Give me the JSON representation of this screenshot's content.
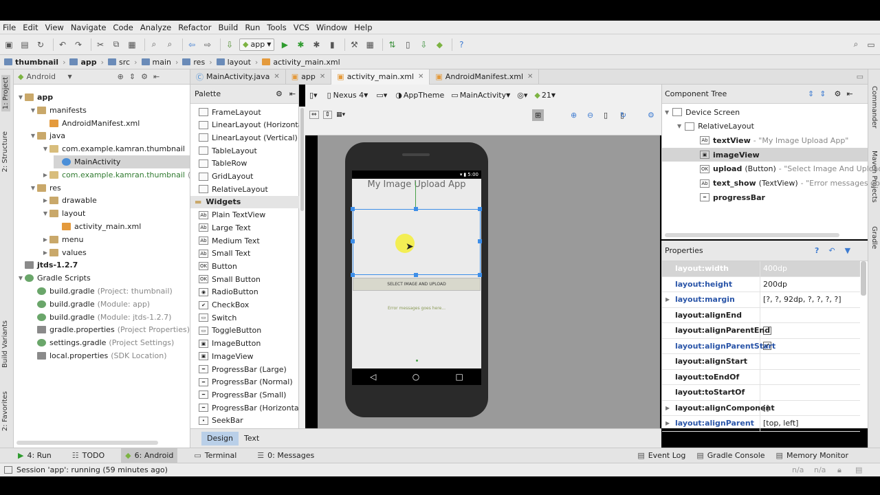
{
  "menu": [
    "File",
    "Edit",
    "View",
    "Navigate",
    "Code",
    "Analyze",
    "Refactor",
    "Build",
    "Run",
    "Tools",
    "VCS",
    "Window",
    "Help"
  ],
  "toolbar": {
    "run_config": "app"
  },
  "breadcrumb": [
    "thumbnail",
    "app",
    "src",
    "main",
    "res",
    "layout",
    "activity_main.xml"
  ],
  "left_strip": {
    "project": "1: Project",
    "structure": "2: Structure",
    "build_variants": "Build Variants",
    "favorites": "2: Favorites"
  },
  "right_strip": {
    "commander": "Commander",
    "maven": "Maven Projects",
    "gradle": "Gradle"
  },
  "project_panel": {
    "view": "Android"
  },
  "tree": [
    {
      "label": "app",
      "indent": 0,
      "arrow": "▼",
      "icon": "folder",
      "bold": true
    },
    {
      "label": "manifests",
      "indent": 1,
      "arrow": "▼",
      "icon": "folder"
    },
    {
      "label": "AndroidManifest.xml",
      "indent": 2,
      "arrow": "",
      "icon": "xml"
    },
    {
      "label": "java",
      "indent": 1,
      "arrow": "▼",
      "icon": "folder"
    },
    {
      "label": "com.example.kamran.thumbnail",
      "indent": 2,
      "arrow": "▼",
      "icon": "pkg"
    },
    {
      "label": "MainActivity",
      "indent": 3,
      "arrow": "",
      "icon": "cls",
      "selected": true
    },
    {
      "label": "com.example.kamran.thumbnail",
      "note": "(an",
      "indent": 2,
      "arrow": "▶",
      "icon": "pkg",
      "green": true
    },
    {
      "label": "res",
      "indent": 1,
      "arrow": "▼",
      "icon": "folder"
    },
    {
      "label": "drawable",
      "indent": 2,
      "arrow": "▶",
      "icon": "folder"
    },
    {
      "label": "layout",
      "indent": 2,
      "arrow": "▼",
      "icon": "folder"
    },
    {
      "label": "activity_main.xml",
      "indent": 3,
      "arrow": "",
      "icon": "xml"
    },
    {
      "label": "menu",
      "indent": 2,
      "arrow": "▶",
      "icon": "folder"
    },
    {
      "label": "values",
      "indent": 2,
      "arrow": "▶",
      "icon": "folder"
    },
    {
      "label": "jtds-1.2.7",
      "indent": 0,
      "arrow": "",
      "icon": "lib",
      "bold": true
    },
    {
      "label": "Gradle Scripts",
      "indent": 0,
      "arrow": "▼",
      "icon": "grd"
    },
    {
      "label": "build.gradle",
      "note": "(Project: thumbnail)",
      "indent": 1,
      "arrow": "",
      "icon": "grd"
    },
    {
      "label": "build.gradle",
      "note": "(Module: app)",
      "indent": 1,
      "arrow": "",
      "icon": "grd"
    },
    {
      "label": "build.gradle",
      "note": "(Module: jtds-1.2.7)",
      "indent": 1,
      "arrow": "",
      "icon": "grd"
    },
    {
      "label": "gradle.properties",
      "note": "(Project Properties)",
      "indent": 1,
      "arrow": "",
      "icon": "lib"
    },
    {
      "label": "settings.gradle",
      "note": "(Project Settings)",
      "indent": 1,
      "arrow": "",
      "icon": "grd"
    },
    {
      "label": "local.properties",
      "note": "(SDK Location)",
      "indent": 1,
      "arrow": "",
      "icon": "lib"
    }
  ],
  "editor_tabs": [
    {
      "label": "MainActivity.java",
      "active": false
    },
    {
      "label": "app",
      "active": false
    },
    {
      "label": "activity_main.xml",
      "active": true
    },
    {
      "label": "AndroidManifest.xml",
      "active": false
    }
  ],
  "palette": {
    "title": "Palette",
    "items": [
      {
        "label": "FrameLayout",
        "ic": ""
      },
      {
        "label": "LinearLayout (Horizontal)",
        "ic": ""
      },
      {
        "label": "LinearLayout (Vertical)",
        "ic": ""
      },
      {
        "label": "TableLayout",
        "ic": ""
      },
      {
        "label": "TableRow",
        "ic": ""
      },
      {
        "label": "GridLayout",
        "ic": ""
      },
      {
        "label": "RelativeLayout",
        "ic": ""
      },
      {
        "label": "Widgets",
        "ic": "",
        "group": true
      },
      {
        "label": "Plain TextView",
        "ic": "Ab"
      },
      {
        "label": "Large Text",
        "ic": "Ab"
      },
      {
        "label": "Medium Text",
        "ic": "Ab"
      },
      {
        "label": "Small Text",
        "ic": "Ab"
      },
      {
        "label": "Button",
        "ic": "OK"
      },
      {
        "label": "Small Button",
        "ic": "OK"
      },
      {
        "label": "RadioButton",
        "ic": "◉"
      },
      {
        "label": "CheckBox",
        "ic": "✔"
      },
      {
        "label": "Switch",
        "ic": "▭"
      },
      {
        "label": "ToggleButton",
        "ic": "▭"
      },
      {
        "label": "ImageButton",
        "ic": "▣"
      },
      {
        "label": "ImageView",
        "ic": "▣"
      },
      {
        "label": "ProgressBar (Large)",
        "ic": "━"
      },
      {
        "label": "ProgressBar (Normal)",
        "ic": "━"
      },
      {
        "label": "ProgressBar (Small)",
        "ic": "━"
      },
      {
        "label": "ProgressBar (Horizontal)",
        "ic": "━"
      },
      {
        "label": "SeekBar",
        "ic": "•"
      }
    ]
  },
  "design_toolbar": {
    "device": "Nexus 4",
    "theme": "AppTheme",
    "activity": "MainActivity",
    "api": "21"
  },
  "phone": {
    "time": "5:00",
    "app_title": "My Image Upload App",
    "button": "SELECT IMAGE AND UPLOAD",
    "error_text": "Error messages goes here..."
  },
  "design_tabs": {
    "design": "Design",
    "text": "Text"
  },
  "component_tree": {
    "title": "Component Tree",
    "items": [
      {
        "name": "Device Screen",
        "desc": "",
        "indent": 0
      },
      {
        "name": "RelativeLayout",
        "desc": "",
        "indent": 1
      },
      {
        "name": "textView",
        "desc": "- \"My Image Upload App\"",
        "indent": 2,
        "ic": "Ab"
      },
      {
        "name": "imageView",
        "desc": "",
        "indent": 2,
        "ic": "▣",
        "selected": true
      },
      {
        "name": "upload",
        "type": "(Button)",
        "desc": "- \"Select Image And Upload\"",
        "indent": 2,
        "ic": "OK"
      },
      {
        "name": "text_show",
        "type": "(TextView)",
        "desc": "- \"Error messages goe",
        "indent": 2,
        "ic": "Ab"
      },
      {
        "name": "progressBar",
        "desc": "",
        "indent": 2,
        "ic": "━"
      }
    ]
  },
  "properties": {
    "title": "Properties",
    "rows": [
      {
        "name": "layout:width",
        "value": "400dp",
        "dim": true
      },
      {
        "name": "layout:height",
        "value": "200dp",
        "blue": true
      },
      {
        "name": "layout:margin",
        "value": "[?, ?, 92dp, ?, ?, ?, ?]",
        "blue": true,
        "arrow": true
      },
      {
        "name": "layout:alignEnd",
        "value": ""
      },
      {
        "name": "layout:alignParentEnd",
        "value": "",
        "check": ""
      },
      {
        "name": "layout:alignParentStart",
        "value": "",
        "check": "✔",
        "blue": true
      },
      {
        "name": "layout:alignStart",
        "value": ""
      },
      {
        "name": "layout:toEndOf",
        "value": ""
      },
      {
        "name": "layout:toStartOf",
        "value": ""
      },
      {
        "name": "layout:alignComponent",
        "value": "[]",
        "arrow": true
      },
      {
        "name": "layout:alignParent",
        "value": "[top, left]",
        "blue": true,
        "arrow": true
      }
    ]
  },
  "bottom_tools": [
    {
      "label": "4: Run",
      "icon": "▶"
    },
    {
      "label": "TODO",
      "icon": "☷"
    },
    {
      "label": "6: Android",
      "icon": "◆",
      "active": true
    },
    {
      "label": "Terminal",
      "icon": "▭"
    },
    {
      "label": "0: Messages",
      "icon": "☰"
    }
  ],
  "bottom_tools_right": [
    {
      "label": "Event Log",
      "icon": "▤"
    },
    {
      "label": "Gradle Console",
      "icon": "▤"
    },
    {
      "label": "Memory Monitor",
      "icon": "▤"
    }
  ],
  "status": {
    "text": "Session 'app': running (59 minutes ago)",
    "na1": "n/a",
    "na2": "n/a"
  }
}
